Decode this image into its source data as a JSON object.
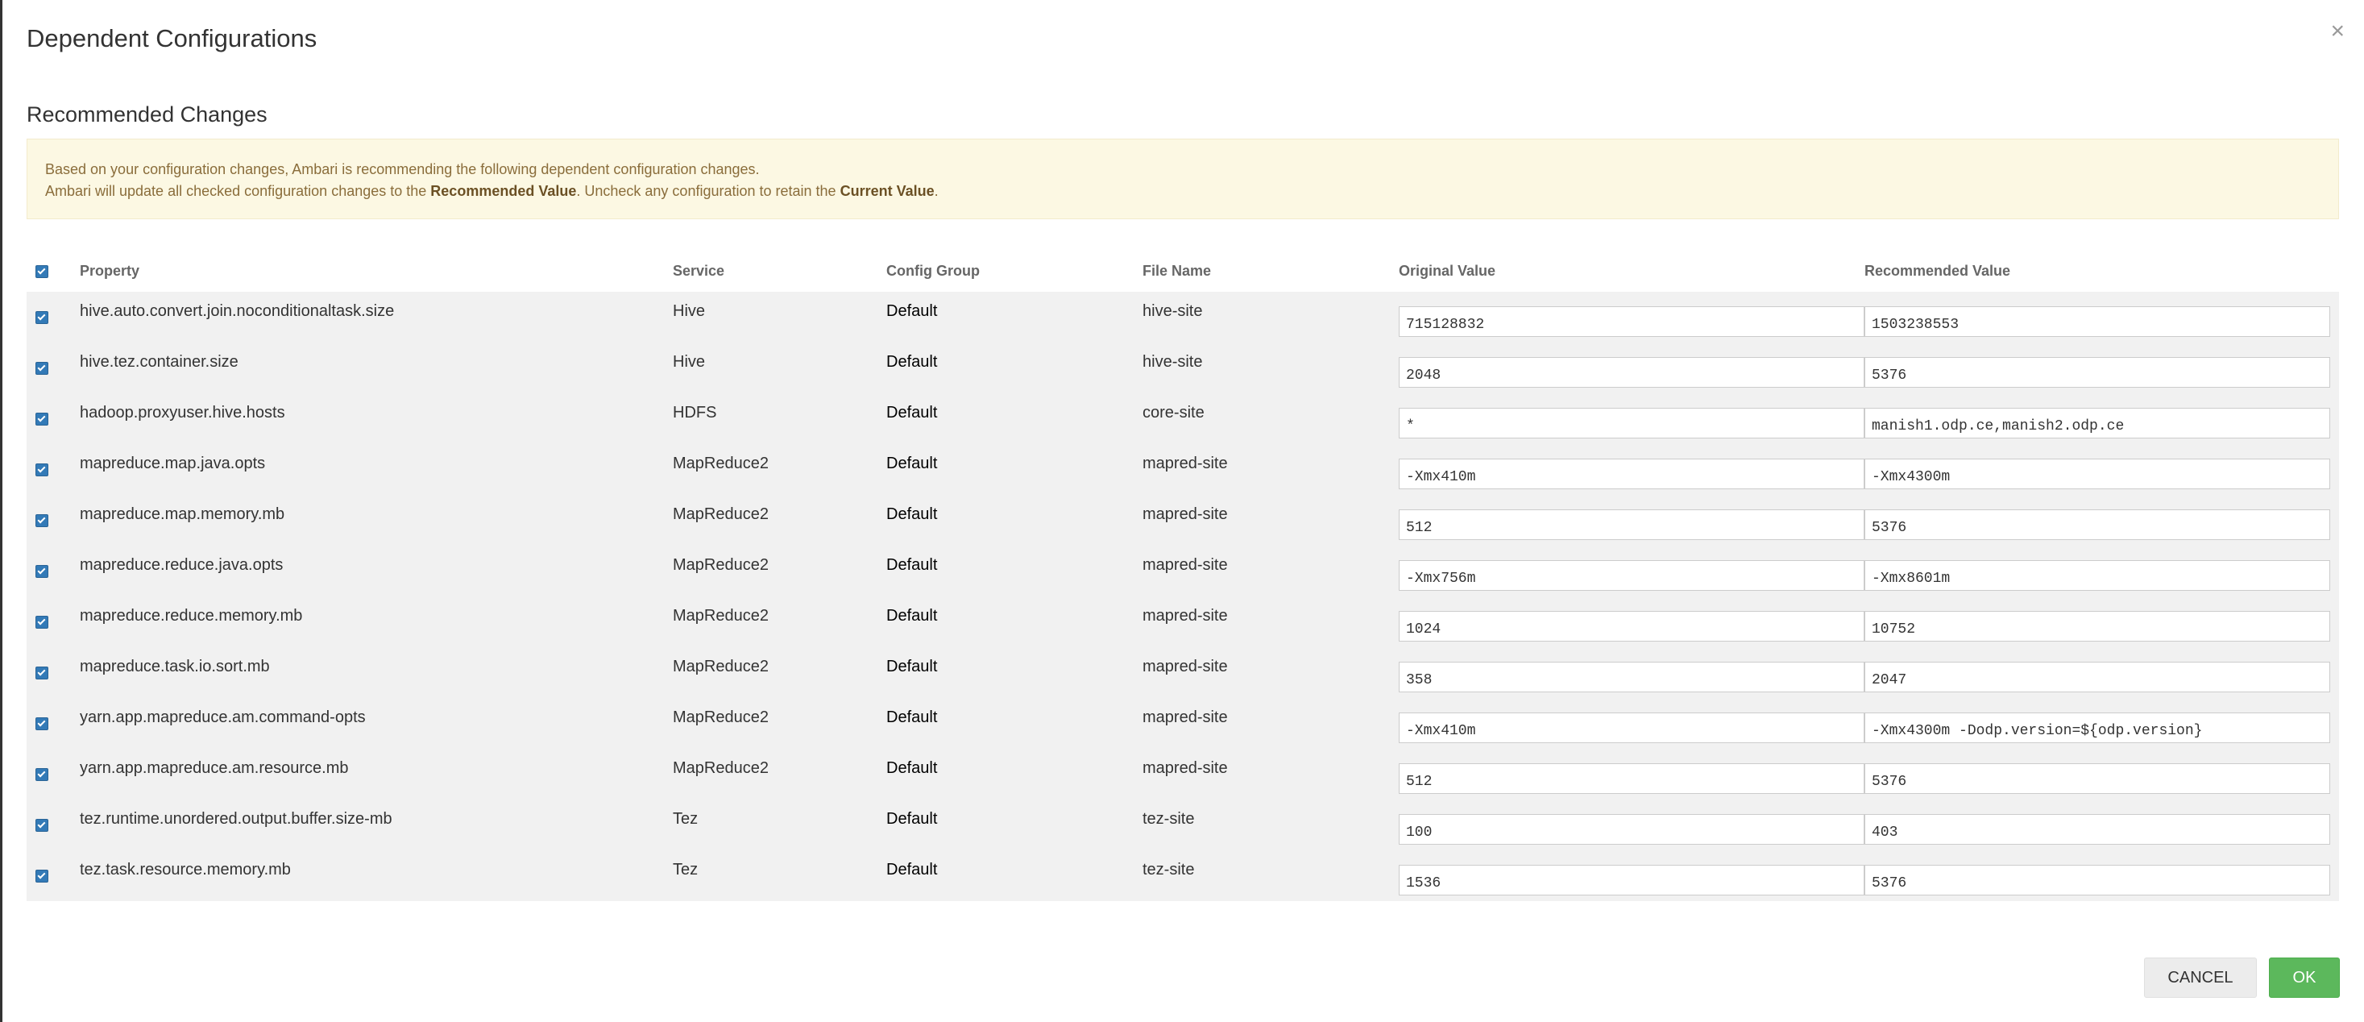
{
  "modal": {
    "title": "Dependent Configurations",
    "close_icon": "close-icon",
    "section_title": "Recommended Changes"
  },
  "alert": {
    "line1": "Based on your configuration changes, Ambari is recommending the following dependent configuration changes.",
    "line2_a": "Ambari will update all checked configuration changes to the ",
    "line2_b": "Recommended Value",
    "line2_c": ". Uncheck any configuration to retain the ",
    "line2_d": "Current Value",
    "line2_e": "."
  },
  "table": {
    "headers": {
      "property": "Property",
      "service": "Service",
      "config_group": "Config Group",
      "file_name": "File Name",
      "original_value": "Original Value",
      "recommended_value": "Recommended Value"
    },
    "all_checked": true,
    "rows": [
      {
        "property": "hive.auto.convert.join.noconditionaltask.size",
        "service": "Hive",
        "group": "Default",
        "file": "hive-site",
        "original": "715128832",
        "recommended": "1503238553",
        "checked": true
      },
      {
        "property": "hive.tez.container.size",
        "service": "Hive",
        "group": "Default",
        "file": "hive-site",
        "original": "2048",
        "recommended": "5376",
        "checked": true
      },
      {
        "property": "hadoop.proxyuser.hive.hosts",
        "service": "HDFS",
        "group": "Default",
        "file": "core-site",
        "original": "*",
        "recommended": "manish1.odp.ce,manish2.odp.ce",
        "checked": true
      },
      {
        "property": "mapreduce.map.java.opts",
        "service": "MapReduce2",
        "group": "Default",
        "file": "mapred-site",
        "original": "-Xmx410m",
        "recommended": "-Xmx4300m",
        "checked": true
      },
      {
        "property": "mapreduce.map.memory.mb",
        "service": "MapReduce2",
        "group": "Default",
        "file": "mapred-site",
        "original": "512",
        "recommended": "5376",
        "checked": true
      },
      {
        "property": "mapreduce.reduce.java.opts",
        "service": "MapReduce2",
        "group": "Default",
        "file": "mapred-site",
        "original": "-Xmx756m",
        "recommended": "-Xmx8601m",
        "checked": true
      },
      {
        "property": "mapreduce.reduce.memory.mb",
        "service": "MapReduce2",
        "group": "Default",
        "file": "mapred-site",
        "original": "1024",
        "recommended": "10752",
        "checked": true
      },
      {
        "property": "mapreduce.task.io.sort.mb",
        "service": "MapReduce2",
        "group": "Default",
        "file": "mapred-site",
        "original": "358",
        "recommended": "2047",
        "checked": true
      },
      {
        "property": "yarn.app.mapreduce.am.command-opts",
        "service": "MapReduce2",
        "group": "Default",
        "file": "mapred-site",
        "original": "-Xmx410m",
        "recommended": "-Xmx4300m -Dodp.version=${odp.version}",
        "checked": true
      },
      {
        "property": "yarn.app.mapreduce.am.resource.mb",
        "service": "MapReduce2",
        "group": "Default",
        "file": "mapred-site",
        "original": "512",
        "recommended": "5376",
        "checked": true
      },
      {
        "property": "tez.runtime.unordered.output.buffer.size-mb",
        "service": "Tez",
        "group": "Default",
        "file": "tez-site",
        "original": "100",
        "recommended": "403",
        "checked": true
      },
      {
        "property": "tez.task.resource.memory.mb",
        "service": "Tez",
        "group": "Default",
        "file": "tez-site",
        "original": "1536",
        "recommended": "5376",
        "checked": true
      }
    ]
  },
  "buttons": {
    "cancel": "CANCEL",
    "ok": "OK"
  },
  "colors": {
    "primary": "#337ab7",
    "ok_green": "#5cb85c",
    "alert_bg": "#fcf8e3"
  }
}
